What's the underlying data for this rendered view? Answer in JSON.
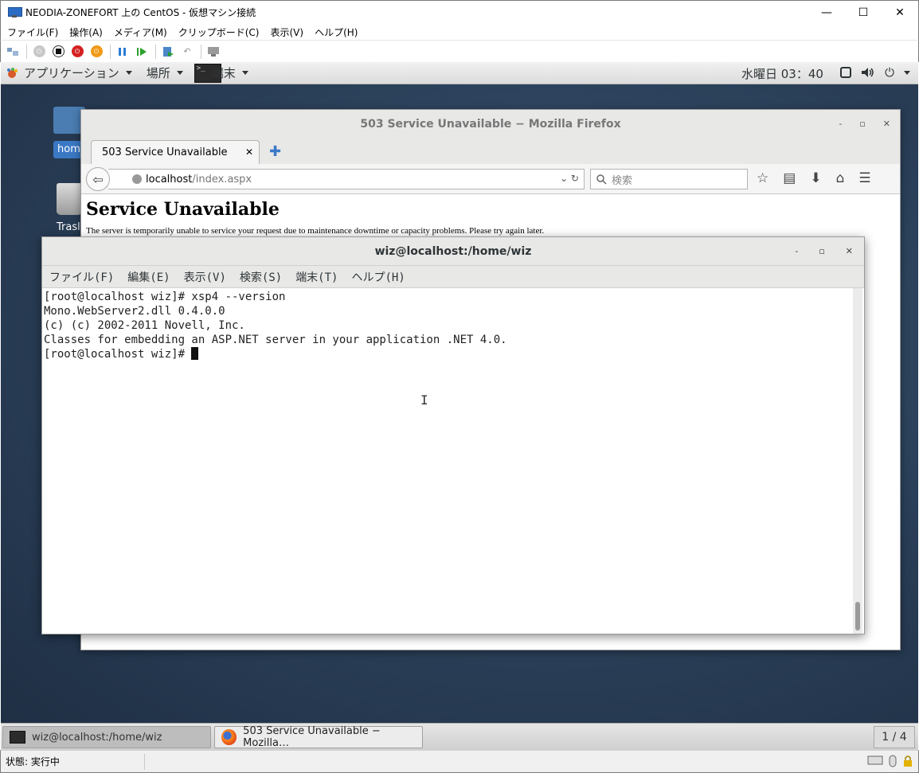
{
  "host": {
    "title": "NEODIA-ZONEFORT 上の CentOS - 仮想マシン接続",
    "window_controls": {
      "minimize": "—",
      "maximize": "☐",
      "close": "✕"
    },
    "menu": [
      "ファイル(F)",
      "操作(A)",
      "メディア(M)",
      "クリップボード(C)",
      "表示(V)",
      "ヘルプ(H)"
    ],
    "status_text": "状態: 実行中"
  },
  "gnome": {
    "applications": "アプリケーション",
    "places": "場所",
    "terminal_app": "端末",
    "terminal_icon_glyph": ">_",
    "clock": "水曜日 03：40"
  },
  "desktop": {
    "home_label": "hom",
    "trash_label": "Trasl"
  },
  "firefox": {
    "title": "503 Service Unavailable − Mozilla Firefox",
    "tab_label": "503 Service Unavailable",
    "url_host": "localhost",
    "url_path": "/index.aspx",
    "search_placeholder": "検索",
    "heading": "Service Unavailable",
    "paragraph": "The server is temporarily unable to service your request due to maintenance downtime or capacity problems. Please try again later."
  },
  "terminal": {
    "title": "wiz@localhost:/home/wiz",
    "menu": [
      "ファイル(F)",
      "編集(E)",
      "表示(V)",
      "検索(S)",
      "端末(T)",
      "ヘルプ(H)"
    ],
    "lines": [
      "[root@localhost wiz]# xsp4 --version",
      "Mono.WebServer2.dll 0.4.0.0",
      "(c) (c) 2002-2011 Novell, Inc.",
      "Classes for embedding an ASP.NET server in your application .NET 4.0."
    ],
    "prompt": "[root@localhost wiz]# "
  },
  "taskbar": {
    "item1": "wiz@localhost:/home/wiz",
    "item2": "503 Service Unavailable − Mozilla…",
    "workspace": "1 / 4"
  },
  "colors": {
    "accent_blue": "#3a78c4",
    "desktop_bg": "#2a3f58"
  }
}
